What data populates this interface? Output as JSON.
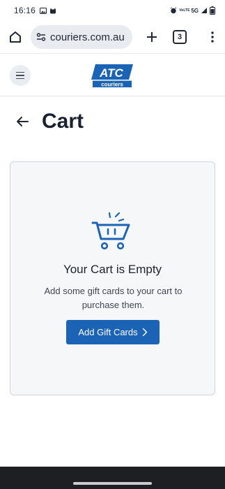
{
  "status_bar": {
    "time": "16:16",
    "left_icons": [
      "image-icon",
      "cat-icon"
    ],
    "right_icons": [
      "alarm-icon",
      "volte-icon",
      "5g-icon",
      "signal-icon",
      "battery-icon"
    ],
    "net_label_top": "VoLTE",
    "net_label": "5G"
  },
  "browser": {
    "url": "couriers.com.au",
    "tab_count": "3"
  },
  "site": {
    "logo_text": "ATC",
    "logo_subtext": "couriers",
    "brand_color": "#1b63b4"
  },
  "page": {
    "title": "Cart"
  },
  "cart": {
    "empty_title": "Your Cart is Empty",
    "empty_description": "Add some gift cards to your cart to purchase them.",
    "add_button_label": "Add Gift Cards",
    "add_button_icon": "chevron-right-icon"
  }
}
